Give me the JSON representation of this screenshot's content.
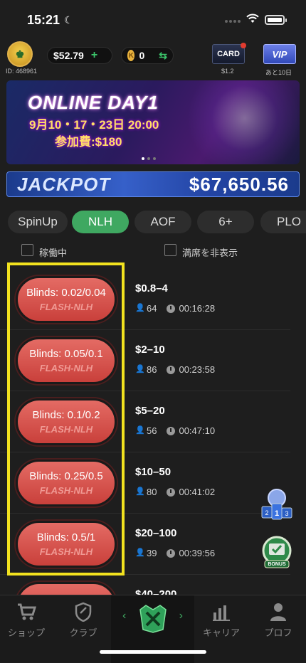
{
  "status": {
    "time": "15:21"
  },
  "header": {
    "user_id": "ID: 468961",
    "balance": "$52.79",
    "plus": "+",
    "coin_symbol": "K",
    "coins": "0",
    "swap": "⇆",
    "card_label": "CARD",
    "card_sub": "$1.2",
    "vip_label": "VIP",
    "vip_sub": "あと10日"
  },
  "banner": {
    "title": "ONLINE DAY1",
    "dates": "9月10・17・23日 20:00",
    "fee": "参加費:$180"
  },
  "jackpot": {
    "label": "JACKPOT",
    "value": "$67,650.56"
  },
  "tabs": [
    "SpinUp",
    "NLH",
    "AOF",
    "6+",
    "PLO"
  ],
  "active_tab": "NLH",
  "filters": {
    "running": "稼働中",
    "hide_full": "満席を非表示"
  },
  "tables": [
    {
      "blinds": "Blinds: 0.02/0.04",
      "game": "FLASH-NLH",
      "stakes": "$0.8–4",
      "players": "64",
      "time": "00:16:28"
    },
    {
      "blinds": "Blinds: 0.05/0.1",
      "game": "FLASH-NLH",
      "stakes": "$2–10",
      "players": "86",
      "time": "00:23:58"
    },
    {
      "blinds": "Blinds: 0.1/0.2",
      "game": "FLASH-NLH",
      "stakes": "$5–20",
      "players": "56",
      "time": "00:47:10"
    },
    {
      "blinds": "Blinds: 0.25/0.5",
      "game": "FLASH-NLH",
      "stakes": "$10–50",
      "players": "80",
      "time": "00:41:02"
    },
    {
      "blinds": "Blinds: 0.5/1",
      "game": "FLASH-NLH",
      "stakes": "$20–100",
      "players": "39",
      "time": "00:39:56"
    },
    {
      "blinds": "",
      "game": "",
      "stakes": "$40–200",
      "players": "",
      "time": ""
    }
  ],
  "bonus_badge": "BONUS",
  "bottom_nav": {
    "shop": "ショップ",
    "club": "クラブ",
    "career": "キャリア",
    "profile": "プロフ"
  },
  "colors": {
    "accent": "#3fa861",
    "blind_button": "#d9534f",
    "highlight": "#f2e21f"
  }
}
